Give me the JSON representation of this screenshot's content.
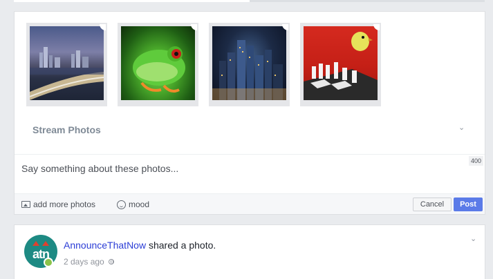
{
  "composer": {
    "photos": [
      {
        "name": "city skyline at dusk"
      },
      {
        "name": "green tree frog"
      },
      {
        "name": "city at night"
      },
      {
        "name": "bird on chess board"
      }
    ],
    "album_label": "Stream Photos",
    "text_placeholder": "Say something about these photos...",
    "char_counter": "400",
    "add_photos_label": "add more photos",
    "mood_label": "mood",
    "cancel_label": "Cancel",
    "post_label": "Post"
  },
  "post": {
    "author": "AnnounceThatNow",
    "action_text": "shared a photo.",
    "timestamp": "2 days ago",
    "avatar_text": "atn"
  },
  "colors": {
    "post_button": "#5b7be8",
    "author_link": "#2b3dd6",
    "online_status": "#8bc34a",
    "avatar_bg": "#1d8a83"
  },
  "icons": {
    "photo": "photo-icon",
    "mood": "smiley-icon",
    "privacy": "globe-icon",
    "menu": "chevron-down-icon"
  }
}
